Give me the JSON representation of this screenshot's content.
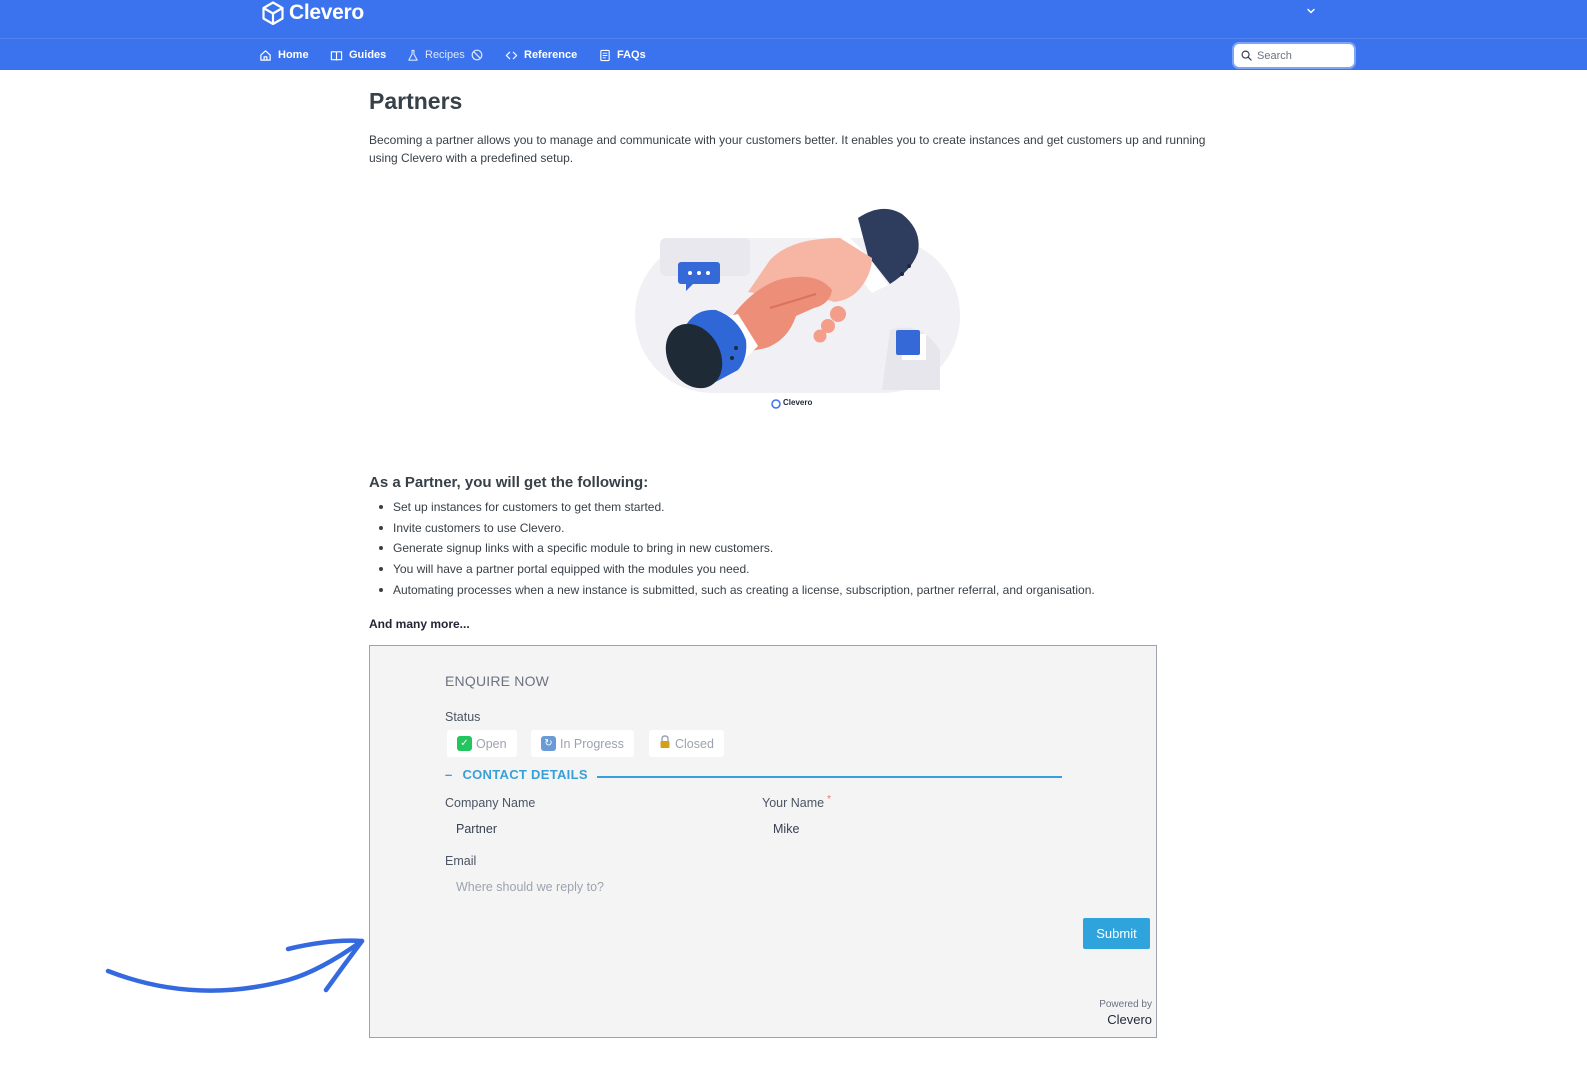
{
  "header": {
    "brand_name": "Clevero",
    "brand_icon": "cube-logo-icon",
    "account_menu_icon": "chevron-down-icon",
    "accent_color": "#3b73ee"
  },
  "nav": {
    "items": [
      {
        "label": "Home",
        "icon": "home-icon"
      },
      {
        "label": "Guides",
        "icon": "book-icon"
      },
      {
        "label": "Recipes",
        "icon": "flask-icon"
      },
      {
        "label": "Reference",
        "icon": "code-icon"
      },
      {
        "label": "FAQs",
        "icon": "document-icon"
      }
    ],
    "search_placeholder": "Search"
  },
  "main": {
    "title": "Partners",
    "intro": "Becoming a partner allows you to manage and communicate with your customers better. It enables you to create instances and get customers up and running using Clevero with a predefined setup.",
    "hero_logo_text": "Clevero",
    "benefits_heading": "As a Partner, you will get the following:",
    "benefits": [
      "Set up instances for customers to get them started.",
      "Invite customers to use Clevero.",
      "Generate signup links with a specific module to bring in new customers.",
      "You will have a partner portal equipped with the modules you need.",
      "Automating processes when a new instance is submitted, such as creating a license, subscription, partner referral, and organisation."
    ],
    "more": "And many more..."
  },
  "form": {
    "title": "ENQUIRE NOW",
    "status_label": "Status",
    "status_options": [
      {
        "label": "Open",
        "icon": "check-mark-icon",
        "color": "#22c55e"
      },
      {
        "label": "In Progress",
        "icon": "refresh-icon",
        "color": "#3b82f6"
      },
      {
        "label": "Closed",
        "icon": "lock-icon",
        "color": "#d4a017"
      }
    ],
    "section_collapse": "–",
    "section_title": "CONTACT DETAILS",
    "company_label": "Company Name",
    "company_value": "Partner",
    "name_label": "Your Name",
    "name_required": "*",
    "name_value": "Mike",
    "email_label": "Email",
    "email_placeholder": "Where should we reply to?",
    "submit_label": "Submit",
    "powered_by": "Powered by",
    "powered_brand": "Clevero",
    "accent_color": "#2ea3dc"
  }
}
